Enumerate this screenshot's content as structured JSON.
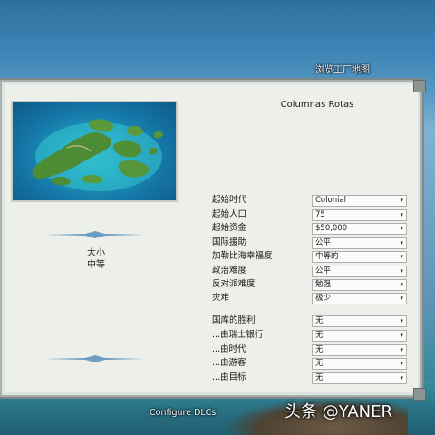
{
  "window": {
    "top_label": "浏览工厂地图"
  },
  "map": {
    "title": "Columnas Rotas"
  },
  "size": {
    "label": "大小",
    "value": "中等"
  },
  "settings": [
    {
      "label": "起始时代",
      "value": "Colonial"
    },
    {
      "label": "起始人口",
      "value": "75"
    },
    {
      "label": "起始资金",
      "value": "$50,000"
    },
    {
      "label": "国际援助",
      "value": "公平"
    },
    {
      "label": "加勒比海幸福度",
      "value": "中等的"
    },
    {
      "label": "政治难度",
      "value": "公平"
    },
    {
      "label": "反对派难度",
      "value": "勉强"
    },
    {
      "label": "灾难",
      "value": "极少"
    }
  ],
  "victory": [
    {
      "label": "国库的胜利",
      "value": "无"
    },
    {
      "label": "...由瑞士银行",
      "value": "无"
    },
    {
      "label": "...由时代",
      "value": "无"
    },
    {
      "label": "...由游客",
      "value": "无"
    },
    {
      "label": "...由目标",
      "value": "无"
    }
  ],
  "footer": {
    "configure_dlcs": "Configure DLCs"
  },
  "watermark": {
    "text": "头条 @YANER"
  },
  "colors": {
    "panel_bg": "#ecefea",
    "sea": "#1e9ec0"
  }
}
